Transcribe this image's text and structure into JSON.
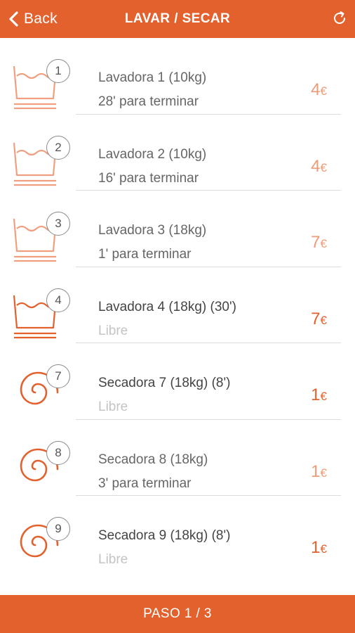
{
  "header": {
    "back_label": "Back",
    "title": "LAVAR / SECAR",
    "back_icon": "chevron-left-icon",
    "refresh_icon": "refresh-icon"
  },
  "machines": [
    {
      "number": "1",
      "name": "Lavadora 1 (10kg)",
      "status": "28' para terminar",
      "price": "4",
      "currency": "€",
      "type": "washer",
      "available": false
    },
    {
      "number": "2",
      "name": "Lavadora 2 (10kg)",
      "status": "16' para terminar",
      "price": "4",
      "currency": "€",
      "type": "washer",
      "available": false
    },
    {
      "number": "3",
      "name": "Lavadora 3 (18kg)",
      "status": "1' para terminar",
      "price": "7",
      "currency": "€",
      "type": "washer",
      "available": false
    },
    {
      "number": "4",
      "name": "Lavadora 4 (18kg) (30')",
      "status": "Libre",
      "price": "7",
      "currency": "€",
      "type": "washer",
      "available": true
    },
    {
      "number": "7",
      "name": "Secadora 7 (18kg) (8')",
      "status": "Libre",
      "price": "1",
      "currency": "€",
      "type": "dryer",
      "available": true
    },
    {
      "number": "8",
      "name": "Secadora 8 (18kg)",
      "status": "3' para terminar",
      "price": "1",
      "currency": "€",
      "type": "dryer",
      "available": false
    },
    {
      "number": "9",
      "name": "Secadora 9 (18kg) (8')",
      "status": "Libre",
      "price": "1",
      "currency": "€",
      "type": "dryer",
      "available": true
    }
  ],
  "footer": {
    "label": "PASO 1 / 3"
  },
  "colors": {
    "accent": "#e2612d",
    "accent_light": "#f2a98a",
    "free_text": "#c4c4c4"
  }
}
